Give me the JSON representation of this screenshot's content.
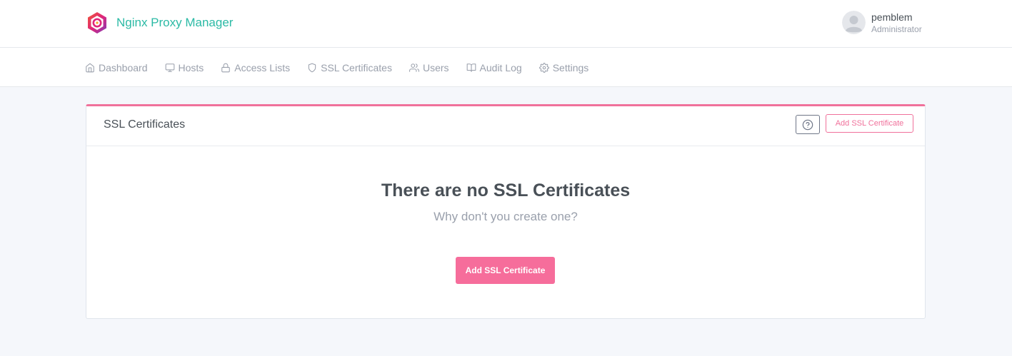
{
  "header": {
    "brand_name": "Nginx Proxy Manager",
    "user": {
      "name": "pemblem",
      "role": "Administrator"
    }
  },
  "nav": {
    "items": [
      {
        "label": "Dashboard",
        "icon": "home-icon"
      },
      {
        "label": "Hosts",
        "icon": "monitor-icon"
      },
      {
        "label": "Access Lists",
        "icon": "lock-icon"
      },
      {
        "label": "SSL Certificates",
        "icon": "shield-icon"
      },
      {
        "label": "Users",
        "icon": "users-icon"
      },
      {
        "label": "Audit Log",
        "icon": "book-open-icon"
      },
      {
        "label": "Settings",
        "icon": "gear-icon"
      }
    ]
  },
  "card": {
    "title": "SSL Certificates",
    "add_button_label": "Add SSL Certificate",
    "help_icon": "help-circle-icon",
    "empty_title": "There are no SSL Certificates",
    "empty_subtitle": "Why don't you create one?",
    "empty_add_button_label": "Add SSL Certificate"
  },
  "colors": {
    "brand_text": "#2bbaa5",
    "accent_pink": "#f0719b",
    "muted_text": "#9aa0ac",
    "background": "#f5f7fb"
  }
}
